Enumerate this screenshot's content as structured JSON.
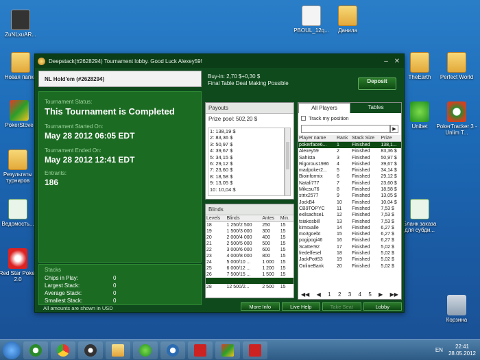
{
  "desktop": {
    "icons_left": [
      "ZuNLxuAR...",
      "Новая папка",
      "PokerStove",
      "Результаты турниров",
      "Ведомость...",
      "Red Star Poker 2.0"
    ],
    "icons_top": [
      "PBOUL_12q...",
      "Данила"
    ],
    "icons_right": [
      "TheEarth",
      "Perfect World",
      "Unibet",
      "PokerTracker 3 - Unlim T...",
      "Бланк заказа для субди...",
      "Корзина"
    ]
  },
  "window": {
    "title": "Deepstack(#2628294) Tournament lobby. Good Luck Alexey59!",
    "game": "NL Hold'em (#2628294)",
    "status_label": "Tournament Status:",
    "status": "This Tournament is Completed",
    "started_label": "Tournament Started On:",
    "started": "May 28 2012  06:05 EDT",
    "ended_label": "Tournament Ended On:",
    "ended": "May 28 2012  12:41 EDT",
    "entrants_label": "Entrants:",
    "entrants": "186",
    "stacks_label": "Stacks",
    "stacks": [
      {
        "k": "Chips in Play:",
        "v": "0"
      },
      {
        "k": "Largest Stack:",
        "v": "0"
      },
      {
        "k": "Average Stack:",
        "v": "0"
      },
      {
        "k": "Smallest Stack:",
        "v": "0"
      }
    ],
    "footer": "All amounts are shown in USD",
    "buyin": "Buy-in: 2,70 $+0,30 $",
    "deal": "Final Table Deal Making Possible",
    "deposit": "Deposit",
    "payouts_label": "Payouts",
    "prize_pool": "Prize pool: 502,20 $",
    "payouts": [
      "1: 138,19 $",
      "2: 83,36 $",
      "3: 50,97 $",
      "4: 39,67 $",
      "5: 34,15 $",
      "6: 29,12 $",
      "7: 23,60 $",
      "8: 18,58 $",
      "9: 13,05 $",
      "10: 10,04 $"
    ],
    "blinds_label": "Blinds",
    "blinds_cols": [
      "Levels",
      "Blinds",
      "Antes",
      "Min."
    ],
    "blinds": [
      [
        "18",
        "1 250/2 500",
        "250",
        "15"
      ],
      [
        "19",
        "1 500/3 000",
        "300",
        "15"
      ],
      [
        "20",
        "2 000/4 000",
        "400",
        "15"
      ],
      [
        "21",
        "2 500/5 000",
        "500",
        "15"
      ],
      [
        "22",
        "3 000/6 000",
        "600",
        "15"
      ],
      [
        "23",
        "4 000/8 000",
        "800",
        "15"
      ],
      [
        "24",
        "5 000/10 ...",
        "1 000",
        "15"
      ],
      [
        "25",
        "6 000/12 ...",
        "1 200",
        "15"
      ],
      [
        "26",
        "7 500/15 ...",
        "1 500",
        "15"
      ],
      [
        "27",
        "",
        "",
        ""
      ],
      [
        "28",
        "12 500/2...",
        "2 500",
        "15"
      ]
    ],
    "tab_players": "All Players",
    "tab_tables": "Tables",
    "track": "Track my position",
    "player_cols": [
      "Player name",
      "Rank",
      "Stack Size",
      "Prize"
    ],
    "players": [
      [
        "pokerface6...",
        "1",
        "Finished",
        "138,1..."
      ],
      [
        "Alexey59",
        "2",
        "Finished",
        "83,36 $"
      ],
      [
        "Sahista",
        "3",
        "Finished",
        "50,97 $"
      ],
      [
        "Rigorous1986",
        "4",
        "Finished",
        "39,67 $"
      ],
      [
        "madpoker2...",
        "5",
        "Finished",
        "34,14 $"
      ],
      [
        "Bioinformix",
        "6",
        "Finished",
        "29,12 $"
      ],
      [
        "Natali777",
        "7",
        "Finished",
        "23,60 $"
      ],
      [
        "Mikcsu76",
        "8",
        "Finished",
        "18,58 $"
      ],
      [
        "strix2577",
        "9",
        "Finished",
        "13,05 $"
      ],
      [
        "JockB4",
        "10",
        "Finished",
        "10,04 $"
      ],
      [
        "CB9TOPYC",
        "11",
        "Finished",
        "7,53 $"
      ],
      [
        "exilsachse1",
        "12",
        "Finished",
        "7,53 $"
      ],
      [
        "tsiakosbill",
        "13",
        "Finished",
        "7,53 $"
      ],
      [
        "kimsvalle",
        "14",
        "Finished",
        "6,27 $"
      ],
      [
        "mo3goebt",
        "15",
        "Finished",
        "6,27 $"
      ],
      [
        "pogipogi46",
        "16",
        "Finished",
        "6,27 $"
      ],
      [
        "Scatter92",
        "17",
        "Finished",
        "5,02 $"
      ],
      [
        "fredelfesel",
        "18",
        "Finished",
        "5,02 $"
      ],
      [
        "JackPott53",
        "19",
        "Finished",
        "5,02 $"
      ],
      [
        "OnlineBank",
        "20",
        "Finished",
        "5,02 $"
      ]
    ],
    "pager": [
      "1",
      "2",
      "3",
      "4",
      "5"
    ],
    "btn_more": "More Info",
    "btn_live": "Live Help",
    "btn_seat": "Take Seat",
    "btn_lobby": "Lobby"
  },
  "taskbar": {
    "lang": "EN",
    "time": "22:41",
    "date": "28.05.2012"
  }
}
